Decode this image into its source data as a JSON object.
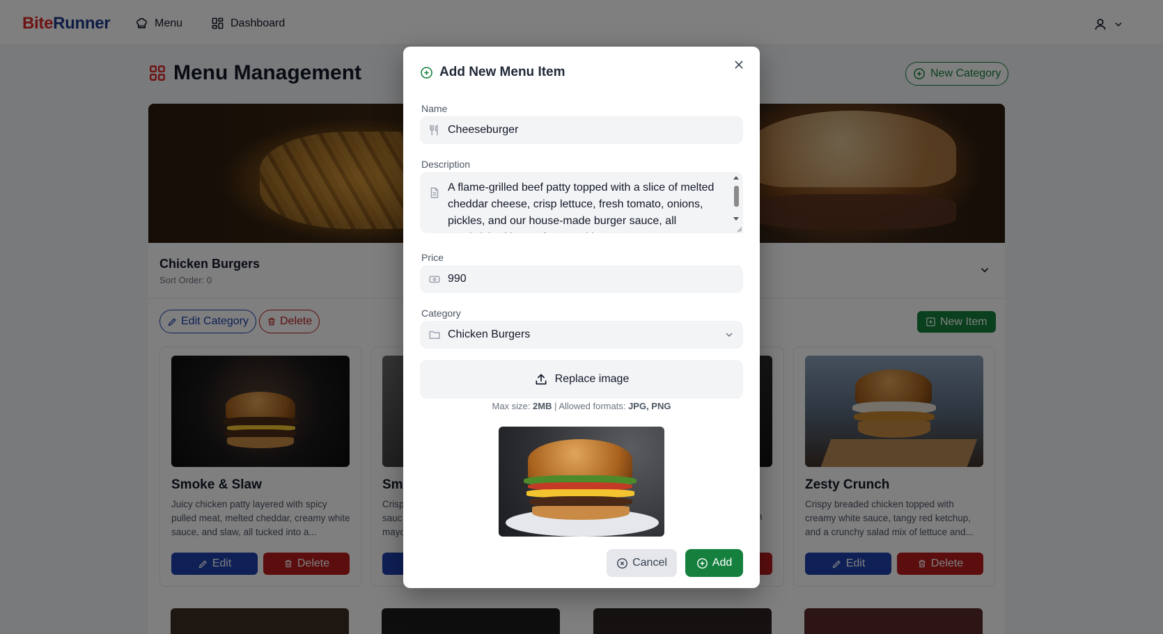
{
  "nav": {
    "brand_part1": "Bite",
    "brand_part2": "Runner",
    "links": [
      {
        "label": "Menu",
        "icon": "chef-hat-icon"
      },
      {
        "label": "Dashboard",
        "icon": "dashboard-grid-icon"
      }
    ],
    "user_icon": "user-icon"
  },
  "page": {
    "title": "Menu Management",
    "new_category_label": "New Category"
  },
  "category": {
    "name": "Chicken Burgers",
    "sort_order": "Sort Order: 0",
    "edit_label": "Edit Category",
    "delete_label": "Delete",
    "new_item_label": "New Item"
  },
  "items": [
    {
      "title": "Smoke & Slaw",
      "description": "Juicy chicken patty layered with spicy pulled meat, melted cheddar, creamy white sauce, and slaw, all tucked into a...",
      "edit_label": "Edit",
      "delete_label": "Delete"
    },
    {
      "title": "Smo",
      "description": "Crisp sauc mayo",
      "edit_label": "",
      "delete_label": ""
    },
    {
      "title": "",
      "description": "n",
      "edit_label": "",
      "delete_label": ""
    },
    {
      "title": "Zesty Crunch",
      "description": "Crispy breaded chicken topped with creamy white sauce, tangy red ketchup, and a crunchy salad mix of lettuce and...",
      "edit_label": "Edit",
      "delete_label": "Delete"
    }
  ],
  "modal": {
    "title": "Add New Menu Item",
    "name_label": "Name",
    "name_value": "Cheeseburger",
    "description_label": "Description",
    "description_value": "A flame-grilled beef patty topped with a slice of melted cheddar cheese, crisp lettuce, fresh tomato, onions, pickles, and our house-made burger sauce, all sandwiched in a soft toasted bun.",
    "price_label": "Price",
    "price_value": "990",
    "category_label": "Category",
    "category_value": "Chicken Burgers",
    "upload_label": "Replace image",
    "hint_prefix": "Max size: ",
    "hint_size": "2MB",
    "hint_middle": " | Allowed formats: ",
    "hint_formats": "JPG, PNG",
    "cancel_label": "Cancel",
    "add_label": "Add"
  },
  "colors": {
    "brand_red": "#dc2626",
    "brand_navy": "#1e3a8a",
    "primary_green": "#15803d",
    "primary_blue": "#1e40af",
    "danger_red": "#b91c1c"
  }
}
